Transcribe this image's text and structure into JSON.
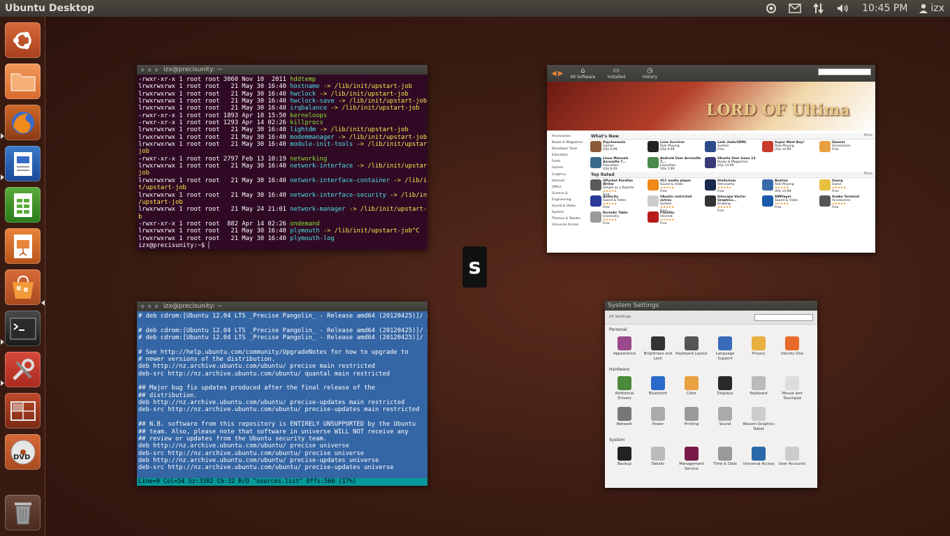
{
  "panel": {
    "title": "Ubuntu Desktop",
    "time": "10:45 PM",
    "user": "izx",
    "icons": [
      "ubuntu-one-icon",
      "mail-icon",
      "network-icon",
      "volume-icon",
      "user-icon"
    ]
  },
  "launcher": {
    "items": [
      {
        "name": "dash-home",
        "icon": "ubuntu-logo-icon"
      },
      {
        "name": "home-folder",
        "icon": "folder-icon"
      },
      {
        "name": "firefox",
        "icon": "firefox-icon"
      },
      {
        "name": "libreoffice-writer",
        "icon": "writer-icon"
      },
      {
        "name": "libreoffice-calc",
        "icon": "calc-icon"
      },
      {
        "name": "libreoffice-impress",
        "icon": "impress-icon"
      },
      {
        "name": "software-center",
        "icon": "shopping-bag-icon"
      },
      {
        "name": "terminal",
        "icon": "terminal-icon"
      },
      {
        "name": "system-settings",
        "icon": "settings-icon"
      },
      {
        "name": "workspace-switcher",
        "icon": "workspace-icon"
      },
      {
        "name": "dvd",
        "icon": "dvd-icon"
      },
      {
        "name": "trash",
        "icon": "trash-icon"
      }
    ]
  },
  "terminal1": {
    "title": "izx@precisunity: ~",
    "lines": [
      [
        "-rwxr-xr-x 1 root root 3060 Nov 10  2011 ",
        "hddtemp",
        "exec",
        ""
      ],
      [
        "lrwxrwxrwx 1 root root   21 May 30 16:40 ",
        "hostname",
        "link",
        " -> /lib/init/upstart-job"
      ],
      [
        "lrwxrwxrwx 1 root root   21 May 30 16:40 ",
        "hwclock",
        "link",
        " -> /lib/init/upstart-job"
      ],
      [
        "lrwxrwxrwx 1 root root   21 May 30 16:40 ",
        "hwclock-save",
        "link",
        " -> /lib/init/upstart-job"
      ],
      [
        "lrwxrwxrwx 1 root root   21 May 30 16:40 ",
        "irqbalance",
        "link",
        " -> /lib/init/upstart-job"
      ],
      [
        "-rwxr-xr-x 1 root root 1893 Apr 18 15:50 ",
        "kerneloops",
        "exec",
        ""
      ],
      [
        "-rwxr-xr-x 1 root root 1293 Apr 14 02:26 ",
        "killprocs",
        "exec",
        ""
      ],
      [
        "lrwxrwxrwx 1 root root   21 May 30 16:40 ",
        "lightdm",
        "link",
        " -> /lib/init/upstart-job"
      ],
      [
        "lrwxrwxrwx 1 root root   21 May 30 16:40 ",
        "modemmanager",
        "link",
        " -> /lib/init/upstart-job"
      ],
      [
        "lrwxrwxrwx 1 root root   21 May 30 16:40 ",
        "module-init-tools",
        "link",
        " -> /lib/init/upstart-"
      ],
      [
        "job",
        "",
        "target",
        ""
      ],
      [
        "-rwxr-xr-x 1 root root 2797 Feb 13 10:19 ",
        "networking",
        "exec",
        ""
      ],
      [
        "lrwxrwxrwx 1 root root   21 May 30 16:40 ",
        "network-interface",
        "link",
        " -> /lib/init/upstart-"
      ],
      [
        "job",
        "",
        "target",
        ""
      ],
      [
        "lrwxrwxrwx 1 root root   21 May 30 16:40 ",
        "network-interface-container",
        "link",
        " -> /lib/ini"
      ],
      [
        "t/upstart-job",
        "",
        "target",
        ""
      ],
      [
        "lrwxrwxrwx 1 root root   21 May 30 16:40 ",
        "network-interface-security",
        "link",
        " -> /lib/init"
      ],
      [
        "/upstart-job",
        "",
        "target",
        ""
      ],
      [
        "lrwxrwxrwx 1 root root   21 May 24 21:01 ",
        "network-manager",
        "link",
        " -> /lib/init/upstart-jo"
      ],
      [
        "b",
        "",
        "target",
        ""
      ],
      [
        "-rwxr-xr-x 1 root root  882 Apr 14 02:26 ",
        "ondemand",
        "exec",
        ""
      ],
      [
        "lrwxrwxrwx 1 root root   21 May 30 16:40 ",
        "plymouth",
        "link",
        " -> /lib/init/upstart-job^C"
      ],
      [
        "lrwxrwxrwx 1 root root   21 May 30 16:40 ",
        "plymouth-log",
        "link",
        ""
      ],
      [
        "izx@precisunity:~$ ",
        "",
        "",
        ""
      ]
    ]
  },
  "terminal2": {
    "title": "izx@precisunity: ~",
    "text": "# deb cdrom:[Ubuntu 12.04 LTS _Precise Pangolin_ - Release amd64 (20120425)]/ di\n\n# deb cdrom:[Ubuntu 12.04 LTS _Precise Pangolin_ - Release amd64 (20120425)]/ di\n# deb cdrom:[Ubuntu 12.04 LTS _Precise Pangolin_ - Release amd64 (20120425)]/ pr\n\n# See http://help.ubuntu.com/community/UpgradeNotes for how to upgrade to\n# newer versions of the distribution.\ndeb http://nz.archive.ubuntu.com/ubuntu/ precise main restricted\ndeb-src http://nz.archive.ubuntu.com/ubuntu/ quantal main restricted\n\n## Major bug fix updates produced after the final release of the\n## distribution.\ndeb http://nz.archive.ubuntu.com/ubuntu/ precise-updates main restricted\ndeb-src http://nz.archive.ubuntu.com/ubuntu/ precise-updates main restricted\n\n## N.B. software from this repository is ENTIRELY UNSUPPORTED by the Ubuntu\n## team. Also, please note that software in universe WILL NOT receive any\n## review or updates from the Ubuntu security team.\ndeb http://nz.archive.ubuntu.com/ubuntu/ precise universe\ndeb-src http://nz.archive.ubuntu.com/ubuntu/ precise universe\ndeb http://nz.archive.ubuntu.com/ubuntu/ precise-updates universe\ndeb-src http://nz.archive.ubuntu.com/ubuntu/ precise-updates universe",
    "status": "Line=9     Col=54   Sz:3382   Ch:32   R/O    \"sources.list\" Offs:560 (17%)"
  },
  "software_center": {
    "tabs": [
      "All Software",
      "Installed",
      "History"
    ],
    "banner_title": "LORD OF Ultima",
    "categories": [
      "Accessories",
      "Books & Magazines",
      "Developer Tools",
      "Education",
      "Fonts",
      "Games",
      "Graphics",
      "Internet",
      "Office",
      "Science & Engineering",
      "Sound & Video",
      "System",
      "Themes & Tweaks",
      "Universal Access"
    ],
    "whats_new": "What's New",
    "top_rated": "Top Rated",
    "more": "More",
    "new_items": [
      {
        "name": "Psychonauts",
        "cat": "Games",
        "price": "US$ 9.99",
        "color": "#8a5a3a"
      },
      {
        "name": "Lone Survivor",
        "cat": "Role-Playing",
        "price": "US$ 9.99",
        "color": "#222222"
      },
      {
        "name": "Leds (leds/ORM)",
        "cat": "System",
        "price": "Free",
        "color": "#2a4a8a"
      },
      {
        "name": "Super Meat Boy!",
        "cat": "Role-Playing",
        "price": "US$ 14.99",
        "color": "#c93a2a"
      },
      {
        "name": "Qwazar",
        "cat": "Accessories",
        "price": "Free",
        "color": "#e8a040"
      },
      {
        "name": "Linux Manuals Acrosofie 7...",
        "cat": "Education",
        "price": "US$ 8.49",
        "color": "#3a6a8a"
      },
      {
        "name": "Android User Acrosofie 7...",
        "cat": "Education",
        "price": "US$ 5.99",
        "color": "#4a8a4a"
      },
      {
        "name": "Ubuntu User Issue 13",
        "cat": "Books & Magazines",
        "price": "US$ 14.99",
        "color": "#3a3a7a"
      },
      {
        "name": "",
        "cat": "",
        "price": "",
        "color": "#ffffff"
      },
      {
        "name": "",
        "cat": "",
        "price": "",
        "color": "#ffffff"
      }
    ],
    "rated_items": [
      {
        "name": "QPocket Parallax Writer",
        "cat": "Simple as a Rewrite",
        "price": "Free",
        "color": "#5a5a5a"
      },
      {
        "name": "VLC media player",
        "cat": "Sound & Video",
        "price": "Free",
        "color": "#f08a18"
      },
      {
        "name": "Stellarium",
        "cat": "Astronomy",
        "price": "Free",
        "color": "#1a2a4a"
      },
      {
        "name": "Bastion",
        "cat": "Role-Playing",
        "price": "US$ 14.99",
        "color": "#3a6aaa"
      },
      {
        "name": "Gourg",
        "cat": "Game",
        "price": "Free",
        "color": "#e8c040"
      },
      {
        "name": "Audacity",
        "cat": "Sound & Video",
        "price": "Free",
        "color": "#2a3a9a"
      },
      {
        "name": "Ubuntu restricted extras",
        "cat": "System",
        "price": "Free",
        "color": "#cccccc"
      },
      {
        "name": "Inkscape Vector Graphics...",
        "cat": "Drawing",
        "price": "Free",
        "color": "#333333"
      },
      {
        "name": "SMPlayer",
        "cat": "Sound & Video",
        "price": "Free",
        "color": "#1a5aaa"
      },
      {
        "name": "Guake Terminal",
        "cat": "Accessories",
        "price": "Free",
        "color": "#555555"
      },
      {
        "name": "Periodic Table",
        "cat": "Chemistry",
        "price": "Free",
        "color": "#9a9a9a"
      },
      {
        "name": "FileZilla",
        "cat": "Internet",
        "price": "Free",
        "color": "#b81a1a"
      },
      {
        "name": "",
        "cat": "",
        "price": "",
        "color": "#ffffff"
      },
      {
        "name": "",
        "cat": "",
        "price": "",
        "color": "#ffffff"
      },
      {
        "name": "",
        "cat": "",
        "price": "",
        "color": "#ffffff"
      }
    ]
  },
  "system_settings": {
    "title": "System Settings",
    "all_settings": "All Settings",
    "sections": [
      {
        "label": "Personal",
        "items": [
          {
            "label": "Appearance",
            "color": "#9a4a8a"
          },
          {
            "label": "Brightness and Lock",
            "color": "#333333"
          },
          {
            "label": "Keyboard Layout",
            "color": "#555555"
          },
          {
            "label": "Language Support",
            "color": "#3a6aba"
          },
          {
            "label": "Privacy",
            "color": "#e8b040"
          },
          {
            "label": "Ubuntu One",
            "color": "#e86a2a"
          }
        ]
      },
      {
        "label": "Hardware",
        "items": [
          {
            "label": "Additional Drivers",
            "color": "#4a8a3a"
          },
          {
            "label": "Bluetooth",
            "color": "#2a6aca"
          },
          {
            "label": "Color",
            "color": "#e8a040"
          },
          {
            "label": "Displays",
            "color": "#2a2a2a"
          },
          {
            "label": "Keyboard",
            "color": "#bbbbbb"
          },
          {
            "label": "Mouse and Touchpad",
            "color": "#dddddd"
          },
          {
            "label": "Network",
            "color": "#777777"
          },
          {
            "label": "Power",
            "color": "#aaaaaa"
          },
          {
            "label": "Printing",
            "color": "#999999"
          },
          {
            "label": "Sound",
            "color": "#aaaaaa"
          },
          {
            "label": "Wacom Graphics Tablet",
            "color": "#cccccc"
          }
        ]
      },
      {
        "label": "System",
        "items": [
          {
            "label": "Backup",
            "color": "#222222"
          },
          {
            "label": "Details",
            "color": "#bbbbbb"
          },
          {
            "label": "Management Service",
            "color": "#7a1a4a"
          },
          {
            "label": "Time & Date",
            "color": "#999999"
          },
          {
            "label": "Universal Access",
            "color": "#2a6aaa"
          },
          {
            "label": "User Accounts",
            "color": "#cccccc"
          }
        ]
      }
    ]
  },
  "keyhint": "s"
}
